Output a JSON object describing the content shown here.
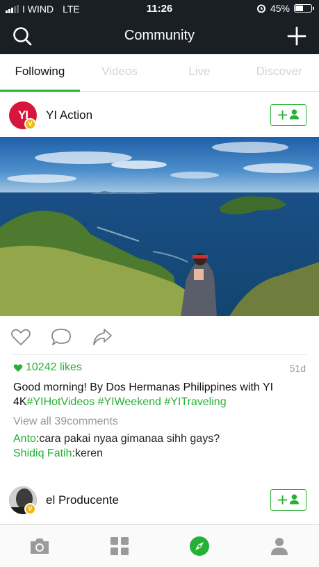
{
  "status_bar": {
    "carrier": "I WIND",
    "network": "LTE",
    "time": "11:26",
    "battery": "45%"
  },
  "header": {
    "title": "Community"
  },
  "tabs": [
    {
      "label": "Following",
      "active": true
    },
    {
      "label": "Videos",
      "active": false
    },
    {
      "label": "Live",
      "active": false
    },
    {
      "label": "Discover",
      "active": false
    }
  ],
  "post": {
    "avatar_text": "YI",
    "verified": "V",
    "username": "YI Action",
    "likes_count": "10242 likes",
    "age": "51d",
    "caption_text": "Good morning! By Dos Hermanas Philippines with YI 4K",
    "hashtags": [
      "#YIHotVideos",
      "#YIWeekend",
      "#YITraveling"
    ],
    "view_comments": "View all 39comments",
    "comments": [
      {
        "user": "Anto",
        "text": "cara pakai nyaa gimanaa sihh gays?"
      },
      {
        "user": "Shidiq Fatih",
        "text": "keren"
      }
    ]
  },
  "next_post": {
    "username": "el Producente",
    "verified": "V"
  },
  "colors": {
    "accent": "#26b036",
    "bar": "#1a1f26",
    "badge": "#f3b615",
    "yi_red": "#d6163c"
  },
  "bottom_nav": [
    "camera-icon",
    "grid-icon",
    "compass-icon",
    "profile-icon"
  ]
}
